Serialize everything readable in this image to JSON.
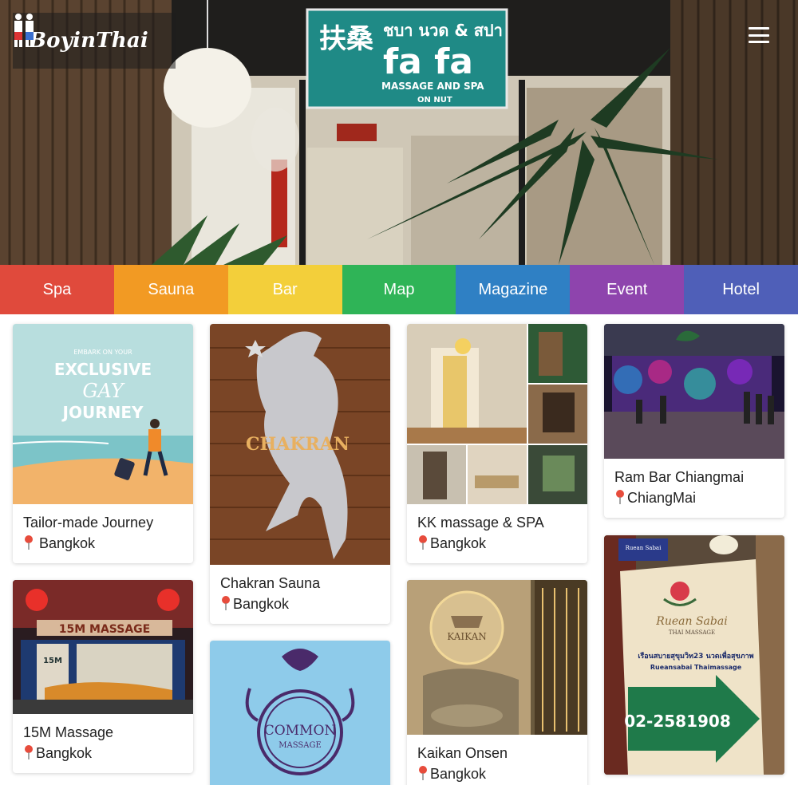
{
  "brand": {
    "name": "BoyinThai"
  },
  "hero": {
    "sign_chinese": "扶桑",
    "sign_thai": "ชบา นวด & สปา",
    "sign_name": "fa fa",
    "sign_subtitle": "MASSAGE AND SPA",
    "sign_location": "ON NUT"
  },
  "nav": {
    "items": [
      {
        "label": "Spa",
        "color": "#e04a3c"
      },
      {
        "label": "Sauna",
        "color": "#f29a23"
      },
      {
        "label": "Bar",
        "color": "#f3cf3a"
      },
      {
        "label": "Map",
        "color": "#2fb457"
      },
      {
        "label": "Magazine",
        "color": "#2f80c4"
      },
      {
        "label": "Event",
        "color": "#8e44ad"
      },
      {
        "label": "Hotel",
        "color": "#4f5fb8"
      }
    ]
  },
  "cards": [
    {
      "title": "Tailor-made Journey",
      "location": "Bangkok",
      "image_text": [
        "EMBARK ON YOUR",
        "EXCLUSIVE",
        "GAY",
        "JOURNEY"
      ]
    },
    {
      "title": "Chakran Sauna",
      "location": "Bangkok",
      "image_text": [
        "CHAKRAN"
      ]
    },
    {
      "title": "KK massage & SPA",
      "location": "Bangkok"
    },
    {
      "title": "Ram Bar Chiangmai",
      "location": "ChiangMai"
    },
    {
      "title": "15M Massage",
      "location": "Bangkok",
      "image_text": [
        "15M MASSAGE",
        "15M"
      ]
    },
    {
      "title": "",
      "location": "",
      "image_text": [
        "COMMON",
        "MASSAGE"
      ]
    },
    {
      "title": "Kaikan Onsen",
      "location": "Bangkok",
      "image_text": [
        "KAIKAN"
      ]
    },
    {
      "title": "",
      "location": "",
      "image_text": [
        "Ruean Sabai",
        "THAI MASSAGE",
        "เรือนสบายสุขุมวิท23 นวดเพื่อสุขภาพ",
        "Rueansabai Thaimassage",
        "02-2581908"
      ]
    }
  ]
}
